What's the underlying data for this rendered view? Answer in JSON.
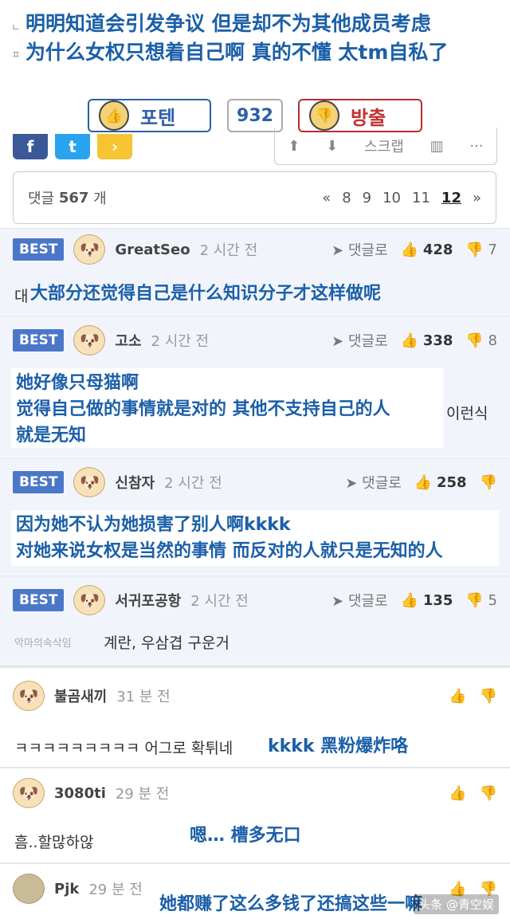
{
  "caption": {
    "line1": "明明知道会引发争议 但是却不为其他成员考虑",
    "line2": "为什么女权只想着自己啊 真的不懂 太tm自私了"
  },
  "vote": {
    "up_label": "포텐",
    "count": "932",
    "down_label": "방출"
  },
  "toolbar": {
    "scrap_label": "스크랩"
  },
  "comments_bar": {
    "label": "댓글",
    "count": "567",
    "unit": "개",
    "pages": [
      "8",
      "9",
      "10",
      "11",
      "12"
    ],
    "prev": "«",
    "next": "»",
    "current_page": "12"
  },
  "best_comments": [
    {
      "badge": "BEST",
      "user": "GreatSeo",
      "time": "2 시간 전",
      "reply_label": "댓글로",
      "likes": "428",
      "dislikes": "7",
      "text_prefix": "대",
      "caption": [
        "大部分还觉得自己是什么知识分子才这样做呢"
      ]
    },
    {
      "badge": "BEST",
      "user": "고소",
      "time": "2 시간 전",
      "reply_label": "댓글로",
      "likes": "338",
      "dislikes": "8",
      "text_suffix": "이런식",
      "caption": [
        "她好像只母猫啊",
        "觉得自己做的事情就是对的 其他不支持自己的人",
        "就是无知"
      ]
    },
    {
      "badge": "BEST",
      "user": "신참자",
      "time": "2 시간 전",
      "reply_label": "댓글로",
      "likes": "258",
      "dislikes": "",
      "caption": [
        "因为她不认为她损害了别人啊kkkk",
        "对她来说女权是当然的事情 而反对的人就只是无知的人"
      ]
    },
    {
      "badge": "BEST",
      "user": "서귀포공항",
      "time": "2 시간 전",
      "reply_label": "댓글로",
      "likes": "135",
      "dislikes": "5",
      "text_prefix": "악마의속삭임",
      "text": "계란, 우삼겹 구운거"
    }
  ],
  "comments": [
    {
      "user": "불곰새끼",
      "time": "31 분 전",
      "text": "ㅋㅋㅋㅋㅋㅋㅋㅋㅋ 어그로 확튀네",
      "caption": "kkkk 黑粉爆炸咯"
    },
    {
      "user": "3080ti",
      "time": "29 분 전",
      "text": "흠..할많하않",
      "caption": "嗯… 槽多无口"
    },
    {
      "user": "Pjk",
      "time": "29 분 전",
      "text": "",
      "caption": "她都赚了这么多钱了还搞这些一嘛"
    }
  ],
  "watermark": "头条 @青空娱"
}
